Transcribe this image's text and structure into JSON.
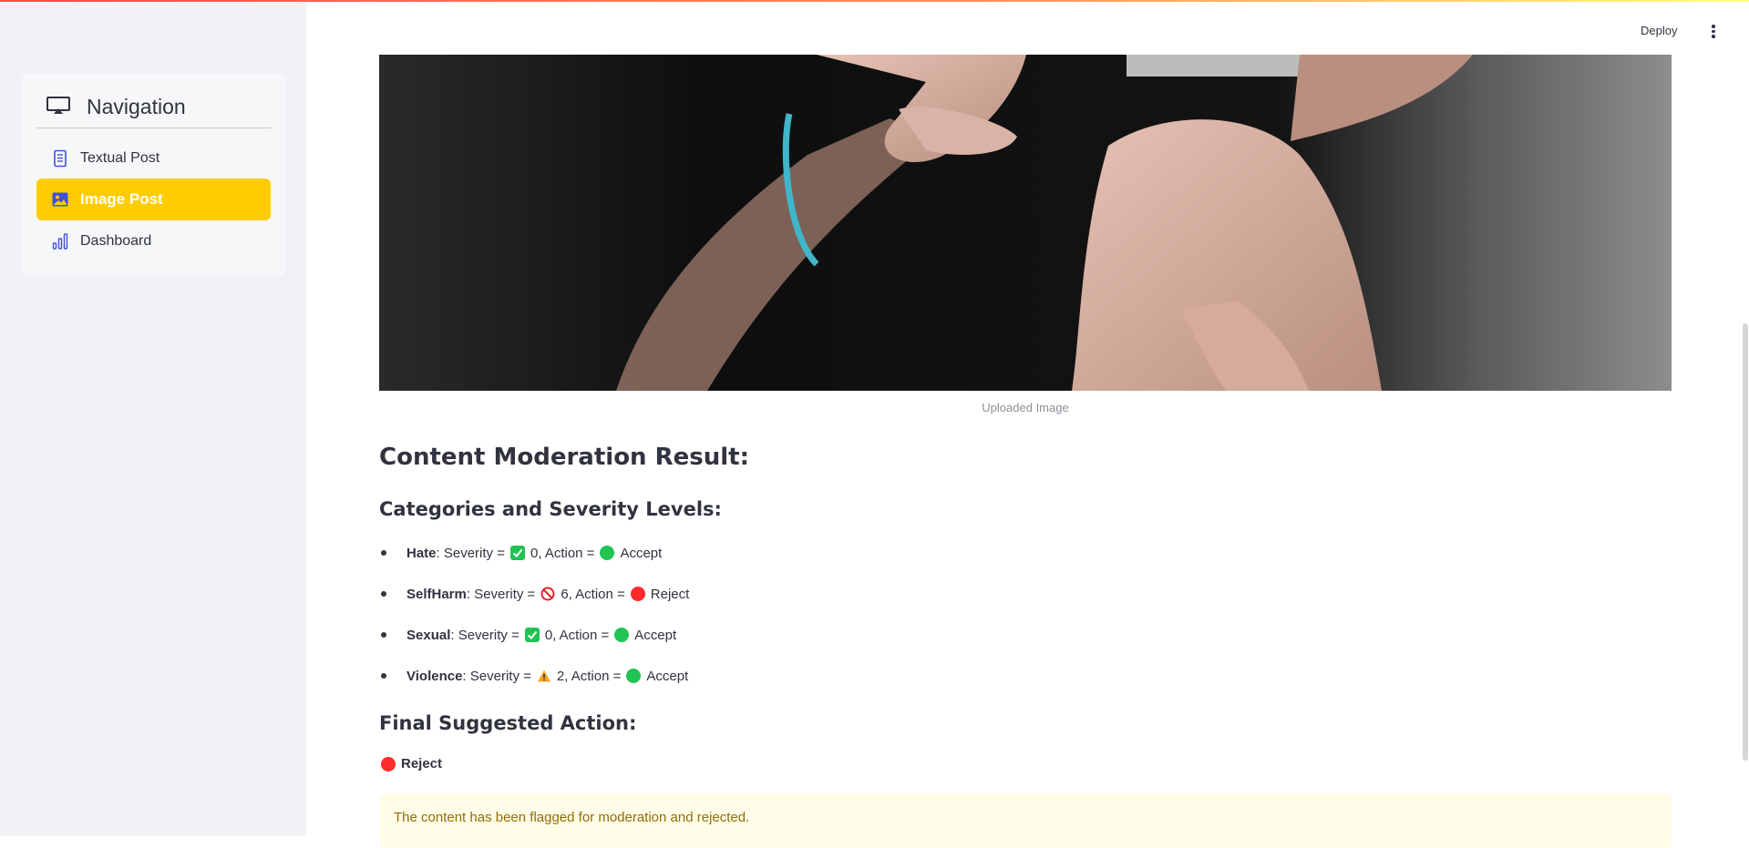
{
  "sidebar": {
    "title": "Navigation",
    "items": [
      {
        "label": "Textual Post",
        "icon": "document-icon",
        "active": false
      },
      {
        "label": "Image Post",
        "icon": "image-icon",
        "active": true
      },
      {
        "label": "Dashboard",
        "icon": "bar-chart-icon",
        "active": false
      }
    ]
  },
  "header": {
    "deploy_label": "Deploy",
    "menu_icon": "kebab-menu-icon"
  },
  "main": {
    "image_caption": "Uploaded Image",
    "result_title": "Content Moderation Result:",
    "categories_title": "Categories and Severity Levels:",
    "categories": [
      {
        "name": "Hate",
        "severity_prefix": ": Severity = ",
        "severity_icon": "check-icon",
        "severity": "0",
        "action_prefix": ", Action = ",
        "action_icon": "green-circle",
        "action": "Accept"
      },
      {
        "name": "SelfHarm",
        "severity_prefix": ": Severity = ",
        "severity_icon": "prohibited-icon",
        "severity": "6",
        "action_prefix": ", Action = ",
        "action_icon": "red-circle",
        "action": "Reject"
      },
      {
        "name": "Sexual",
        "severity_prefix": ": Severity = ",
        "severity_icon": "check-icon",
        "severity": "0",
        "action_prefix": ", Action = ",
        "action_icon": "green-circle",
        "action": "Accept"
      },
      {
        "name": "Violence",
        "severity_prefix": ": Severity = ",
        "severity_icon": "warning-icon",
        "severity": "2",
        "action_prefix": ", Action = ",
        "action_icon": "green-circle",
        "action": "Accept"
      }
    ],
    "final_title": "Final Suggested Action:",
    "final_action": "Reject",
    "final_action_icon": "red-circle",
    "alert_text": "The content has been flagged for moderation and rejected."
  },
  "colors": {
    "accent_active": "#ffcc00",
    "accept_green": "#21c354",
    "reject_red": "#ff2b2b",
    "alert_bg": "#fffde7",
    "alert_text": "#926c05"
  }
}
